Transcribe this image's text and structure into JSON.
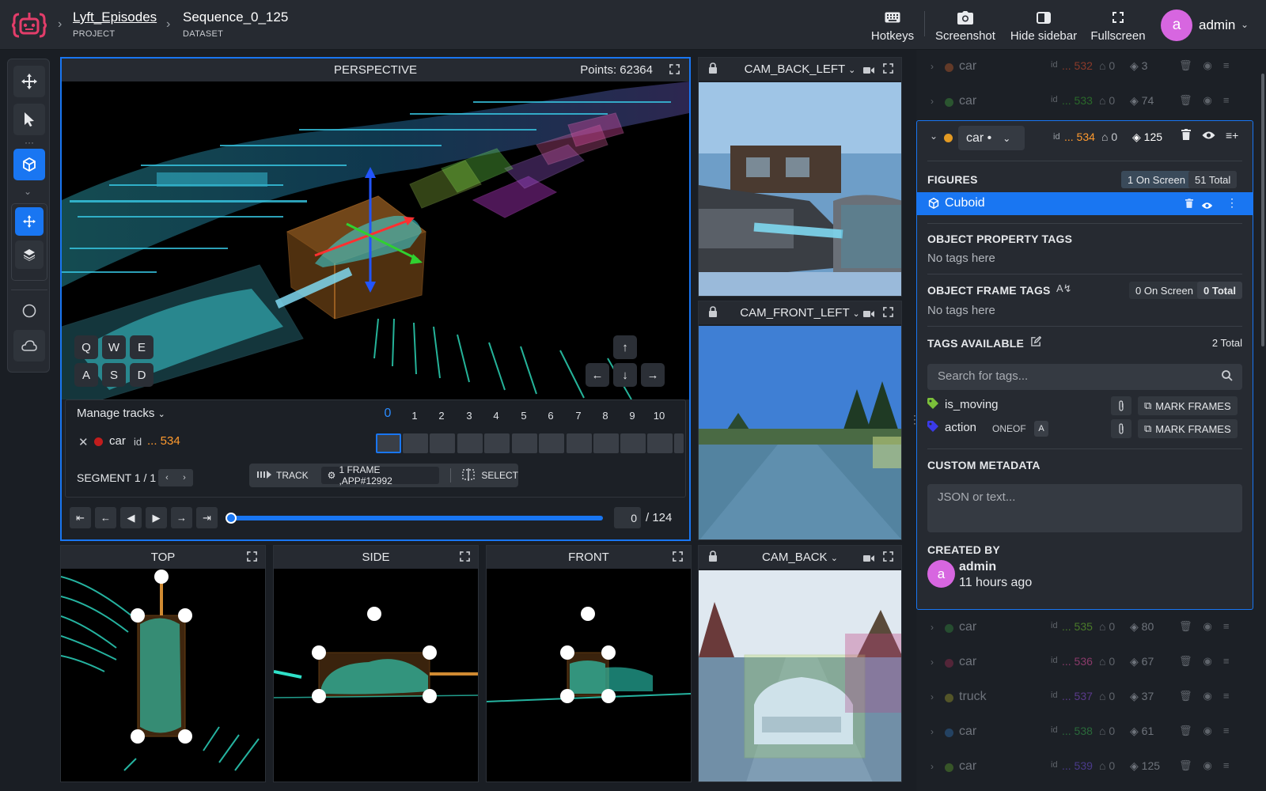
{
  "header": {
    "project_name": "Lyft_Episodes",
    "project_label": "PROJECT",
    "dataset_name": "Sequence_0_125",
    "dataset_label": "DATASET",
    "hotkeys": "Hotkeys",
    "screenshot": "Screenshot",
    "hide_sidebar": "Hide sidebar",
    "fullscreen": "Fullscreen",
    "user_initial": "a",
    "user_name": "admin"
  },
  "perspective": {
    "title": "PERSPECTIVE",
    "points": "Points: 62364",
    "keys": [
      "Q",
      "W",
      "E",
      "A",
      "S",
      "D"
    ]
  },
  "tracks": {
    "manage_label": "Manage tracks",
    "frames": [
      "0",
      "1",
      "2",
      "3",
      "4",
      "5",
      "6",
      "7",
      "8",
      "9",
      "10"
    ],
    "track_class": "car",
    "id_label": "id",
    "id_value": "... 534",
    "segment": "SEGMENT 1 / 1",
    "track_btn": "TRACK",
    "frame_info": "1 FRAME ,APP#12992",
    "select_btn": "SELECT"
  },
  "player": {
    "current_frame": "0",
    "total": "/ 124",
    "progress": 0
  },
  "views": {
    "top": "TOP",
    "side": "SIDE",
    "front": "FRONT"
  },
  "cameras": {
    "back_left": "CAM_BACK_LEFT",
    "front_left": "CAM_FRONT_LEFT",
    "back": "CAM_BACK"
  },
  "objects": {
    "rows_above": [
      {
        "class": "car",
        "id_label": "id",
        "id": "... 532",
        "tags": "0",
        "frames": "3",
        "color": "#a8532a"
      },
      {
        "class": "car",
        "id_label": "id",
        "id": "... 533",
        "tags": "0",
        "frames": "74",
        "color": "#3a8a3a"
      }
    ],
    "rows_below": [
      {
        "class": "car",
        "id_label": "id",
        "id": "... 535",
        "tags": "0",
        "frames": "80",
        "color": "#2f7a3a"
      },
      {
        "class": "car",
        "id_label": "id",
        "id": "... 536",
        "tags": "0",
        "frames": "67",
        "color": "#8a2a4a"
      },
      {
        "class": "truck",
        "id_label": "id",
        "id": "... 537",
        "tags": "0",
        "frames": "37",
        "color": "#8a8a2a"
      },
      {
        "class": "car",
        "id_label": "id",
        "id": "... 538",
        "tags": "0",
        "frames": "61",
        "color": "#2a5a8a"
      },
      {
        "class": "car",
        "id_label": "id",
        "id": "... 539",
        "tags": "0",
        "frames": "125",
        "color": "#4a7a2a"
      }
    ]
  },
  "selected": {
    "class": "car •",
    "id_label": "id",
    "id": "... 534",
    "tags": "0",
    "frames": "125",
    "figures_title": "FIGURES",
    "on_screen": "1 On Screen",
    "total": "51 Total",
    "figure_name": "Cuboid",
    "prop_tags_title": "OBJECT PROPERTY TAGS",
    "no_tags": "No tags here",
    "frame_tags_title": "OBJECT FRAME TAGS",
    "frame_on_screen": "0 On Screen",
    "frame_total": "0 Total",
    "no_tags2": "No tags here",
    "tags_available_title": "TAGS AVAILABLE",
    "tags_available_total": "2 Total",
    "search_placeholder": "Search for tags...",
    "tag1": "is_moving",
    "tag2": "action",
    "tag2_type": "ONEOF",
    "tag2_badge": "A",
    "mark_frames": "MARK FRAMES",
    "custom_meta_title": "CUSTOM METADATA",
    "meta_placeholder": "JSON or text...",
    "created_by_title": "CREATED BY",
    "creator_initial": "a",
    "creator_name": "admin",
    "created_ago": "11 hours ago"
  },
  "colors": {
    "accent": "#1976f2",
    "id_orange": "#ff9a2e",
    "car_dot": "#e39a23"
  }
}
